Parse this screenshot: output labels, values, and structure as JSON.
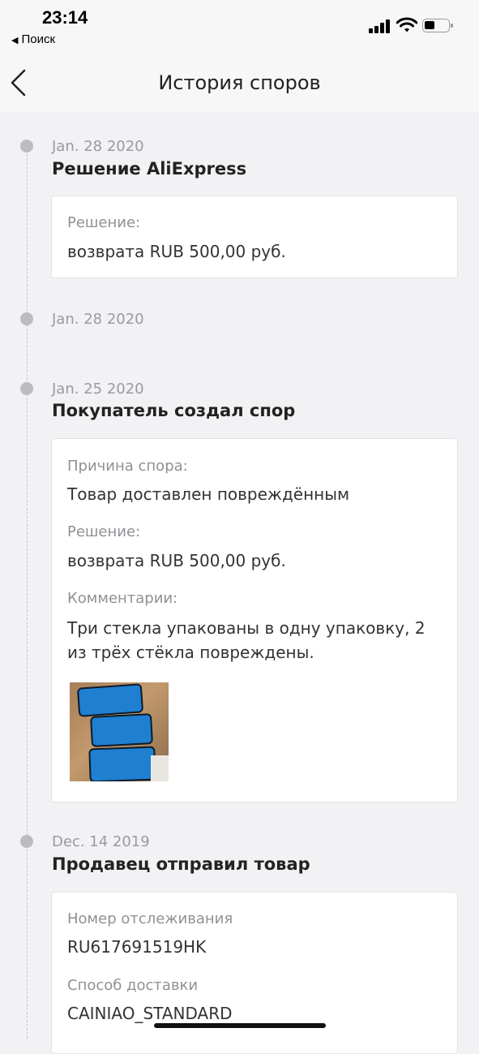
{
  "status_bar": {
    "time": "23:14",
    "back_app": "Поиск",
    "back_arrow": "◀"
  },
  "nav": {
    "title": "История споров",
    "back_icon": "chevron-left-icon"
  },
  "events": [
    {
      "date": "Jan. 28 2020",
      "title": "Решение AliExpress",
      "fields": [
        {
          "label": "Решение:",
          "value": "возврата RUB 500,00 руб."
        }
      ]
    },
    {
      "date": "Jan. 28 2020",
      "title": "",
      "fields": []
    },
    {
      "date": "Jan. 25 2020",
      "title": "Покупатель создал спор",
      "fields": [
        {
          "label": "Причина спора:",
          "value": "Товар доставлен повреждённым"
        },
        {
          "label": "Решение:",
          "value": "возврата RUB 500,00 руб."
        },
        {
          "label": "Комментарии:",
          "value_line1": "Три стекла упакованы в одну упаковку, 2",
          "value_line2": "из трёх стёкла повреждены."
        }
      ],
      "photo": "photo-thumbnail"
    },
    {
      "date": "Dec. 14 2019",
      "title": "Продавец отправил товар",
      "fields": [
        {
          "label": "Номер отслеживания",
          "value": "RU617691519HK"
        },
        {
          "label": "Способ доставки",
          "value": "CAINIAO_STANDARD"
        }
      ]
    }
  ]
}
